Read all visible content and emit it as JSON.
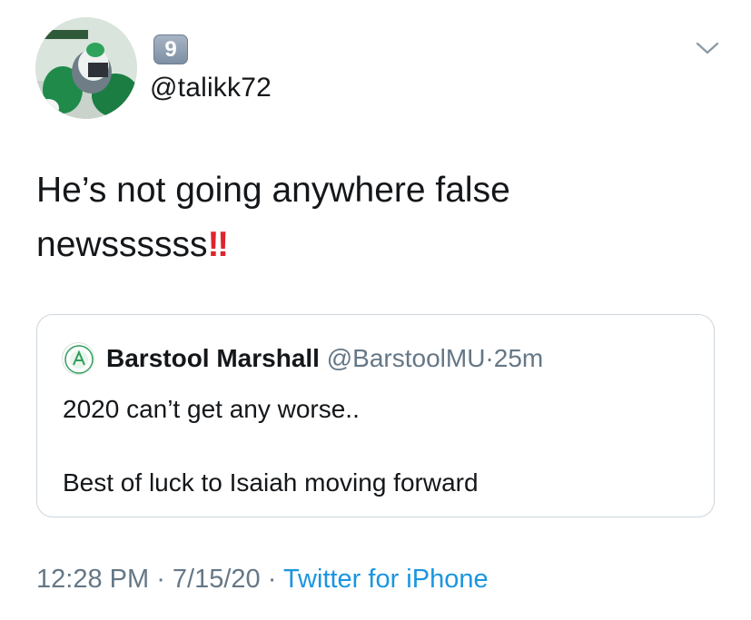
{
  "author": {
    "emoji_badge": "9",
    "handle": "@talikk72",
    "avatar_icon": "profile-photo-football-player"
  },
  "tweet": {
    "text": "He’s not going anywhere false newssssss",
    "emphasis": "‼"
  },
  "quoted_tweet": {
    "name": "Barstool Marshall",
    "handle": "@BarstoolMU",
    "separator": "·",
    "age": "25m",
    "line1": "2020 can’t get any worse..",
    "line2": "Best of luck to Isaiah moving forward"
  },
  "footer": {
    "time": "12:28 PM",
    "sep1": " · ",
    "date": "7/15/20",
    "sep2": " · ",
    "source": "Twitter for iPhone"
  },
  "colors": {
    "link": "#1b95e0",
    "muted": "#657786",
    "border": "#ccd6dd",
    "emphasis": "#e0242c"
  }
}
